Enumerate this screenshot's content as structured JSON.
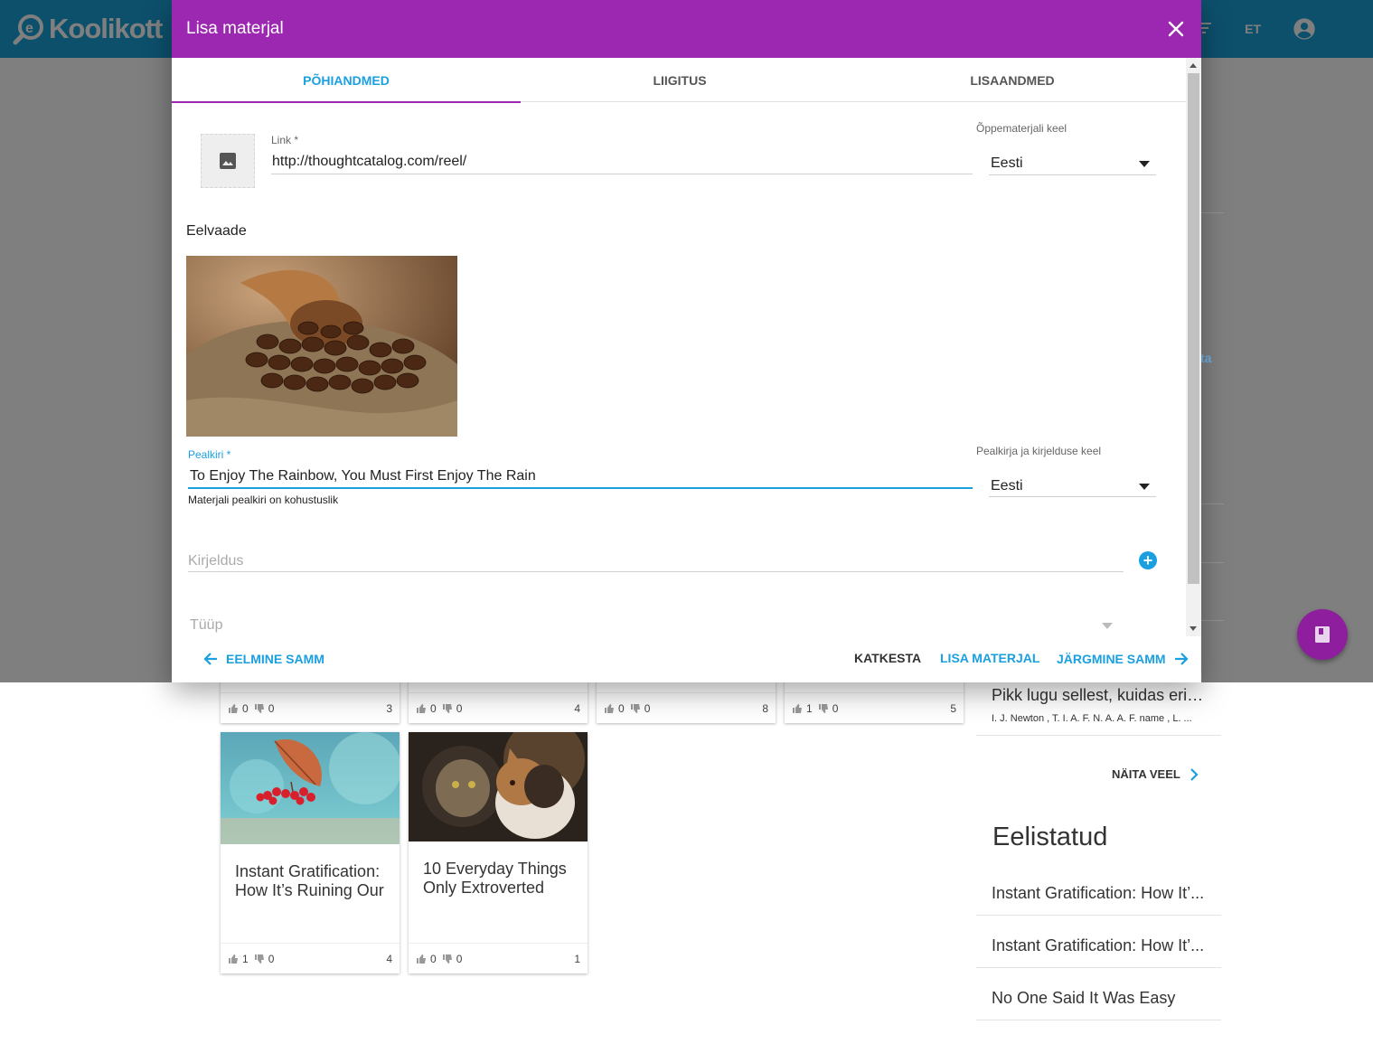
{
  "app": {
    "logo_text": "Koolikott",
    "language": "ET"
  },
  "dialog": {
    "title": "Lisa materjal",
    "tabs": [
      {
        "label": "PÕHIANDMED",
        "active": true
      },
      {
        "label": "LIIGITUS",
        "active": false
      },
      {
        "label": "LISAANDMED",
        "active": false
      }
    ],
    "link": {
      "label": "Link *",
      "value": "http://thoughtcatalog.com/reel/"
    },
    "material_language": {
      "label": "Õppematerjali keel",
      "value": "Eesti"
    },
    "preview_heading": "Eelvaade",
    "title_field": {
      "label": "Pealkiri *",
      "value": "To Enjoy The Rainbow, You Must First Enjoy The Rain",
      "hint": "Materjali pealkiri on kohustuslik"
    },
    "title_language": {
      "label": "Pealkirja ja kirjelduse keel",
      "value": "Eesti"
    },
    "description": {
      "placeholder": "Kirjeldus"
    },
    "type": {
      "placeholder": "Tüüp"
    },
    "buttons": {
      "previous": "EELMINE SAMM",
      "cancel": "KATKESTA",
      "add": "LISA MATERJAL",
      "next": "JÄRGMINE SAMM"
    },
    "colors": {
      "header": "#9c27b0",
      "accent": "#1a9fe0"
    }
  },
  "background": {
    "link_fragment": "ta",
    "cards_row1": [
      {
        "likes": "0",
        "dislikes": "0",
        "views": "3"
      },
      {
        "likes": "0",
        "dislikes": "0",
        "views": "4"
      },
      {
        "likes": "0",
        "dislikes": "0",
        "views": "8"
      },
      {
        "likes": "1",
        "dislikes": "0",
        "views": "5"
      }
    ],
    "cards_row2": [
      {
        "title": "Instant Gratification: How It’s Ruining Our",
        "likes": "1",
        "dislikes": "0",
        "views": "4"
      },
      {
        "title": "10 Everyday Things Only Extroverted",
        "likes": "0",
        "dislikes": "0",
        "views": "1"
      }
    ],
    "sidebar": {
      "recent_item": {
        "title": "Pikk lugu sellest, kuidas erin...",
        "authors": "I. J. Newton , T. I. A. F. N. A. A. F. name , L. ..."
      },
      "show_more": "NÄITA VEEL",
      "favorites_heading": "Eelistatud",
      "favorites": [
        "Instant Gratification: How It’...",
        "Instant Gratification: How It’...",
        "No One Said It Was Easy"
      ]
    }
  }
}
